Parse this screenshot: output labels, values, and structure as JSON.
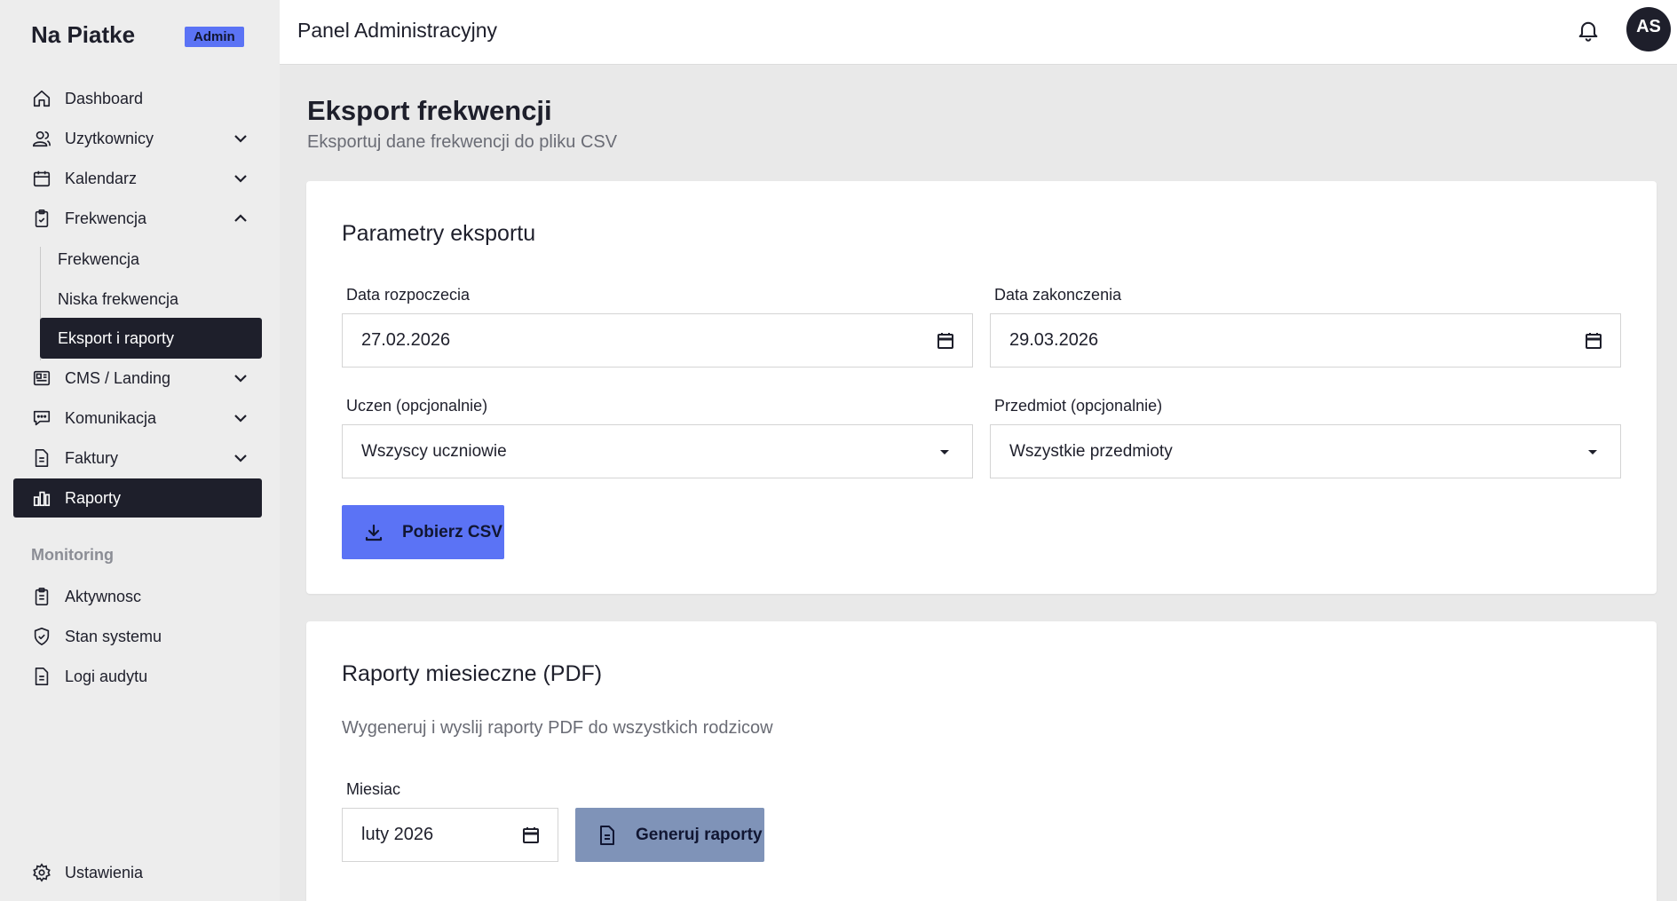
{
  "sidebar": {
    "brand": "Na Piatke",
    "badge": "Admin",
    "items": [
      {
        "label": "Dashboard",
        "icon": "home-icon"
      },
      {
        "label": "Uzytkownicy",
        "icon": "users-icon"
      },
      {
        "label": "Kalendarz",
        "icon": "calendar-icon"
      },
      {
        "label": "Frekwencja",
        "icon": "clipboard-check-icon"
      },
      {
        "label": "CMS / Landing",
        "icon": "newspaper-icon"
      },
      {
        "label": "Komunikacja",
        "icon": "chat-icon"
      },
      {
        "label": "Faktury",
        "icon": "document-icon"
      },
      {
        "label": "Raporty",
        "icon": "bar-chart-icon"
      }
    ],
    "subitems": [
      {
        "label": "Frekwencja"
      },
      {
        "label": "Niska frekwencja"
      },
      {
        "label": "Eksport i raporty"
      }
    ],
    "section_label": "Monitoring",
    "monitoring": [
      {
        "label": "Aktywnosc",
        "icon": "clipboard-list-icon"
      },
      {
        "label": "Stan systemu",
        "icon": "shield-check-icon"
      },
      {
        "label": "Logi audytu",
        "icon": "document-icon"
      }
    ],
    "settings": {
      "label": "Ustawienia",
      "icon": "gear-icon"
    }
  },
  "header": {
    "title": "Panel Administracyjny",
    "avatar_initials": "AS"
  },
  "main": {
    "title": "Eksport frekwencji",
    "subtitle": "Eksportuj dane frekwencji do pliku CSV",
    "export_card": {
      "title": "Parametry eksportu",
      "start_label": "Data rozpoczecia",
      "start_value": "27.02.2026",
      "end_label": "Data zakonczenia",
      "end_value": "29.03.2026",
      "student_label": "Uczen (opcjonalnie)",
      "student_value": "Wszyscy uczniowie",
      "subject_label": "Przedmiot (opcjonalnie)",
      "subject_value": "Wszystkie przedmioty",
      "download_label": "Pobierz CSV"
    },
    "reports_card": {
      "title": "Raporty miesieczne (PDF)",
      "description": "Wygeneruj i wyslij raporty PDF do wszystkich rodzicow",
      "month_label": "Miesiac",
      "month_value": "luty 2026",
      "generate_label": "Generuj raporty"
    }
  },
  "colors": {
    "accent": "#5b73f5",
    "dark": "#1e1f2b",
    "muted_button": "#7f93b8",
    "background": "#e9e9e9"
  }
}
